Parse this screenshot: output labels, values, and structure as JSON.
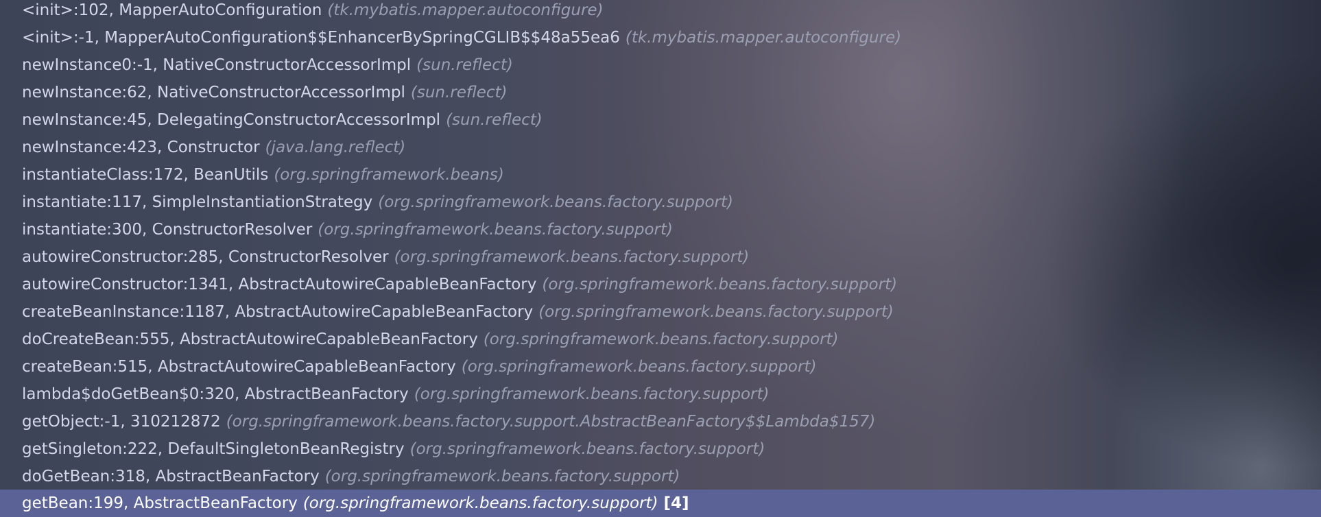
{
  "frames": {
    "items": [
      {
        "method": "<init>:102, MapperAutoConfiguration",
        "package": "(tk.mybatis.mapper.autoconfigure)"
      },
      {
        "method": "<init>:-1, MapperAutoConfiguration$$EnhancerBySpringCGLIB$$48a55ea6",
        "package": "(tk.mybatis.mapper.autoconfigure)"
      },
      {
        "method": "newInstance0:-1, NativeConstructorAccessorImpl",
        "package": "(sun.reflect)"
      },
      {
        "method": "newInstance:62, NativeConstructorAccessorImpl",
        "package": "(sun.reflect)"
      },
      {
        "method": "newInstance:45, DelegatingConstructorAccessorImpl",
        "package": "(sun.reflect)"
      },
      {
        "method": "newInstance:423, Constructor",
        "package": "(java.lang.reflect)"
      },
      {
        "method": "instantiateClass:172, BeanUtils",
        "package": "(org.springframework.beans)"
      },
      {
        "method": "instantiate:117, SimpleInstantiationStrategy",
        "package": "(org.springframework.beans.factory.support)"
      },
      {
        "method": "instantiate:300, ConstructorResolver",
        "package": "(org.springframework.beans.factory.support)"
      },
      {
        "method": "autowireConstructor:285, ConstructorResolver",
        "package": "(org.springframework.beans.factory.support)"
      },
      {
        "method": "autowireConstructor:1341, AbstractAutowireCapableBeanFactory",
        "package": "(org.springframework.beans.factory.support)"
      },
      {
        "method": "createBeanInstance:1187, AbstractAutowireCapableBeanFactory",
        "package": "(org.springframework.beans.factory.support)"
      },
      {
        "method": "doCreateBean:555, AbstractAutowireCapableBeanFactory",
        "package": "(org.springframework.beans.factory.support)"
      },
      {
        "method": "createBean:515, AbstractAutowireCapableBeanFactory",
        "package": "(org.springframework.beans.factory.support)"
      },
      {
        "method": "lambda$doGetBean$0:320, AbstractBeanFactory",
        "package": "(org.springframework.beans.factory.support)"
      },
      {
        "method": "getObject:-1, 310212872",
        "package": "(org.springframework.beans.factory.support.AbstractBeanFactory$$Lambda$157)"
      },
      {
        "method": "getSingleton:222, DefaultSingletonBeanRegistry",
        "package": "(org.springframework.beans.factory.support)"
      },
      {
        "method": "doGetBean:318, AbstractBeanFactory",
        "package": "(org.springframework.beans.factory.support)"
      }
    ],
    "selected": {
      "method": "getBean:199, AbstractBeanFactory",
      "package": "(org.springframework.beans.factory.support)",
      "badge": "[4]"
    }
  },
  "colors": {
    "selection_background": "#5b6396",
    "method_text": "#d3d8e8",
    "package_text": "#9aa0b2"
  }
}
